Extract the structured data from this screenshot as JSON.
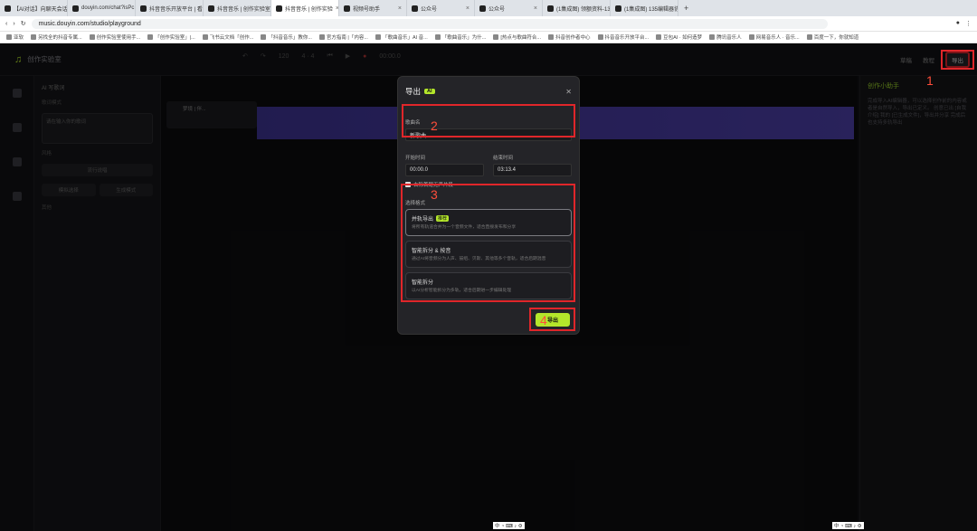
{
  "browser": {
    "tabs": [
      {
        "label": "【AI对话】向聊天会话..."
      },
      {
        "label": "douyin.com/chat?isPc"
      },
      {
        "label": "抖音音乐开放平台 | 看见"
      },
      {
        "label": "抖音音乐 | 创作实验室 |"
      },
      {
        "label": "抖音音乐 | 创作实验",
        "active": true
      },
      {
        "label": "视频号助手"
      },
      {
        "label": "公众号"
      },
      {
        "label": "公众号"
      },
      {
        "label": "(1集成图) 领额资料-13"
      },
      {
        "label": "(1集成图) 135编辑器协"
      }
    ],
    "url": "music.douyin.com/studio/playground",
    "bookmarks": [
      "亚软",
      "另找全的抖音专属...",
      "创作实验室使用手...",
      "「创作实验室」|...",
      "飞书云文档「创作...",
      "「抖音音乐」教你...",
      "官方指南 |「内容...",
      "「歌曲音乐」AI 音...",
      "「歌曲音乐」为什...",
      "[热点与歌曲符合...",
      "抖音创作者中心",
      "抖音音乐开放平台...",
      "豆包AI · 如何造梦",
      "腾讯音乐人",
      "网易音乐人 · 音乐...",
      "百度一下，你就知道"
    ]
  },
  "app": {
    "logo_text": "创作实验室",
    "bpm": "120",
    "time_sig": "4 · 4",
    "timecode": "00:00.0",
    "right_actions": [
      "草稿",
      "教程"
    ],
    "export_top": "导出",
    "left_panel": {
      "title": "AI 写歌词",
      "section": "歌词模式",
      "placeholder": "请在输入你的歌词",
      "style_label": "风格",
      "style_value": "流行说唱",
      "mode_a": "模拟选择",
      "mode_b": "生成模式",
      "extra": "其他"
    },
    "track_name": "梦境 | 伴...",
    "right_panel": {
      "title": "创作小助手",
      "body": "完成导入AI编辑器，可以选择创作前的内容或者是自然导入，导出已定义。 创意已出 [自我介绍] 我的 [已生成文件]，导出并分享 完成后也支持多轨导出"
    }
  },
  "modal": {
    "title": "导出",
    "ai_badge": "AI",
    "song_name_label": "歌曲名",
    "song_name_value": "新歌曲",
    "start_label": "开始时间",
    "start_value": "00:00.0",
    "end_label": "结束时间",
    "end_value": "03:13.4",
    "trim_silence": "去除首尾无声片段",
    "format_label": "选择格式",
    "modes": [
      {
        "title": "并轨导出",
        "badge": "推荐",
        "desc": "将所有轨道合并为一个音频文件，适合直接发布和分享",
        "selected": true
      },
      {
        "title": "智能拆分 & 按音",
        "desc": "通过AI将音频分为人声、鼓组、贝斯、其他等多个音轨，适合后期混音"
      },
      {
        "title": "智能拆分",
        "desc": "以AI分析智能拆分为多轨，适合后期进一步编辑处理"
      }
    ],
    "export_button": "导出"
  },
  "annotations": [
    "1",
    "2",
    "3",
    "4"
  ],
  "colors": {
    "accent": "#b4e62b",
    "highlight": "#e0262a",
    "wave": "#4b3ea6"
  }
}
